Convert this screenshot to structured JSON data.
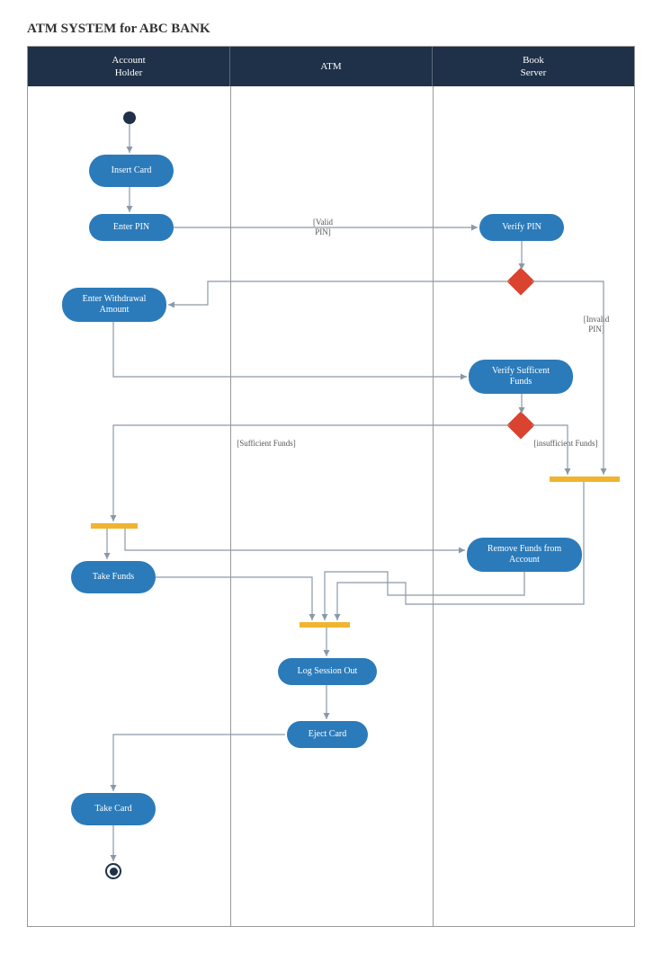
{
  "title": "ATM SYSTEM for ABC BANK",
  "lanes": {
    "accountHolder": "Account\nHolder",
    "atm": "ATM",
    "bookServer": "Book\nServer"
  },
  "activities": {
    "insertCard": "Insert Card",
    "enterPin": "Enter PIN",
    "verifyPin": "Verify PIN",
    "enterWithdrawal": "Enter Withdrawal\nAmount",
    "verifyFunds": "Verify Sufficent\nFunds",
    "removeFunds": "Remove Funds from\nAccount",
    "takeFunds": "Take Funds",
    "logSessionOut": "Log Session Out",
    "ejectCard": "Eject Card",
    "takeCard": "Take Card"
  },
  "edgeLabels": {
    "validPin": "[Valid\nPIN]",
    "invalidPin": "[Invalid\nPIN]",
    "sufficientFunds": "[Sufficient Funds]",
    "insufficientFunds": "[insufficient Funds]"
  }
}
